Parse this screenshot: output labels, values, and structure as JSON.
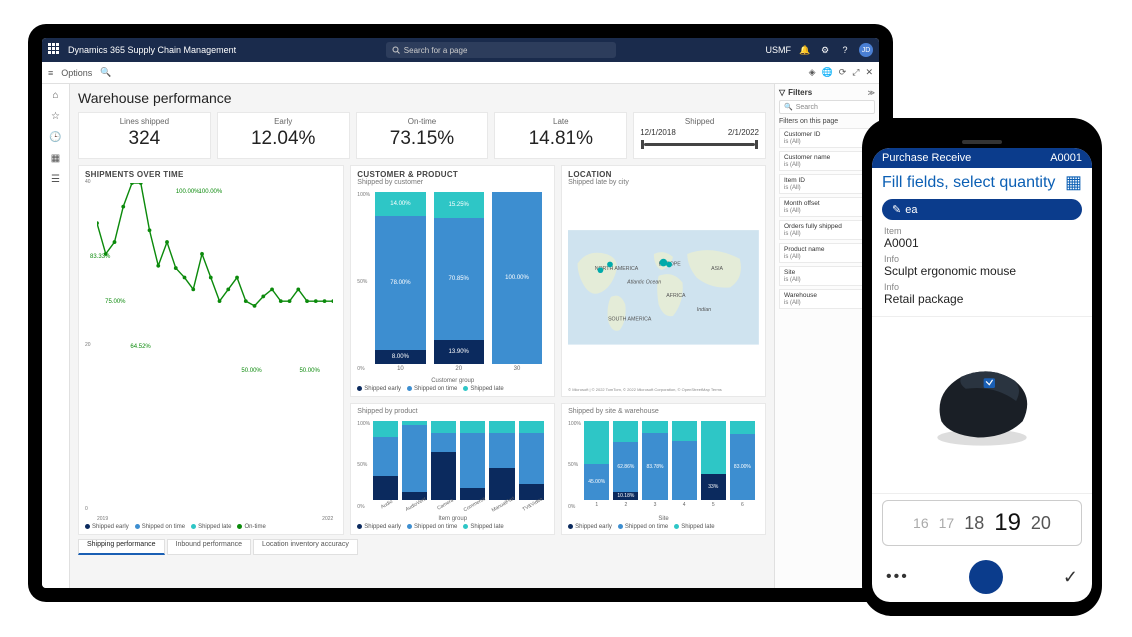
{
  "header": {
    "app_title": "Dynamics 365 Supply Chain Management",
    "search_placeholder": "Search for a page",
    "company": "USMF",
    "avatar_initials": "JD"
  },
  "subheader": {
    "options": "Options"
  },
  "page": {
    "title": "Warehouse performance"
  },
  "kpis": {
    "lines_shipped": {
      "label": "Lines shipped",
      "value": "324"
    },
    "early": {
      "label": "Early",
      "value": "12.04%"
    },
    "on_time": {
      "label": "On-time",
      "value": "73.15%"
    },
    "late": {
      "label": "Late",
      "value": "14.81%"
    },
    "shipped": {
      "label": "Shipped",
      "from": "12/1/2018",
      "to": "2/1/2022"
    }
  },
  "charts": {
    "shipments_over_time": {
      "title": "SHIPMENTS OVER TIME",
      "legend": [
        "Shipped early",
        "Shipped on time",
        "Shipped late",
        "On-time"
      ],
      "callouts": [
        "100.00%",
        "100.00%",
        "83.33%",
        "75.00%",
        "64.52%",
        "50.00%",
        "50.00%"
      ],
      "x_from": "2019",
      "x_to": "2022"
    },
    "customer_product": {
      "title": "CUSTOMER & PRODUCT"
    },
    "shipped_by_customer": {
      "subtitle": "Shipped by customer",
      "axis_label": "Customer group",
      "legend": [
        "Shipped early",
        "Shipped on time",
        "Shipped late"
      ]
    },
    "shipped_by_product": {
      "subtitle": "Shipped by product",
      "axis_label": "Item group",
      "legend": [
        "Shipped early",
        "Shipped on time",
        "Shipped late"
      ]
    },
    "location": {
      "title": "LOCATION"
    },
    "shipped_late_city": {
      "subtitle": "Shipped late by city",
      "regions": {
        "na": "NORTH AMERICA",
        "eu": "EUROPE",
        "asia": "ASIA",
        "af": "AFRICA",
        "sa": "SOUTH AMERICA",
        "ao": "Atlantic Ocean",
        "io": "Indian"
      },
      "attribution": "© Microsoft | © 2022 TomTom, © 2022 Microsoft Corporation, © OpenStreetMap Terms"
    },
    "shipped_by_site": {
      "subtitle": "Shipped by site & warehouse",
      "axis_label": "Site",
      "legend": [
        "Shipped early",
        "Shipped on time",
        "Shipped late"
      ]
    }
  },
  "chart_data": [
    {
      "type": "bar",
      "id": "shipped_by_customer",
      "categories": [
        "10",
        "20",
        "30"
      ],
      "series": [
        {
          "name": "Shipped early",
          "color": "#0b2a5e",
          "values": [
            8.0,
            13.9,
            0.0
          ]
        },
        {
          "name": "Shipped on time",
          "color": "#3d8ed0",
          "values": [
            78.0,
            70.85,
            100.0
          ]
        },
        {
          "name": "Shipped late",
          "color": "#2ec6c6",
          "values": [
            14.0,
            15.25,
            0.0
          ]
        }
      ],
      "ylabel": "%",
      "ylim": [
        0,
        100
      ],
      "xlabel": "Customer group"
    },
    {
      "type": "bar",
      "id": "shipped_by_product",
      "categories": [
        "Audio",
        "AudioVent",
        "Camera",
        "Commerce",
        "ManualPart",
        "TV&Video"
      ],
      "series": [
        {
          "name": "Shipped early",
          "color": "#0b2a5e"
        },
        {
          "name": "Shipped on time",
          "color": "#3d8ed0"
        },
        {
          "name": "Shipped late",
          "color": "#2ec6c6"
        }
      ],
      "ylabel": "%",
      "ylim": [
        0,
        100
      ],
      "xlabel": "Item group"
    },
    {
      "type": "bar",
      "id": "shipped_by_site",
      "categories": [
        "1",
        "2",
        "3",
        "4",
        "5",
        "6"
      ],
      "series": [
        {
          "name": "Shipped early",
          "color": "#0b2a5e",
          "values": [
            null,
            10.18,
            null,
            null,
            33,
            null
          ]
        },
        {
          "name": "Shipped on time",
          "color": "#3d8ed0",
          "values": [
            45.0,
            62.86,
            83.78,
            75,
            null,
            83.0
          ]
        },
        {
          "name": "Shipped late",
          "color": "#2ec6c6",
          "values": [
            55,
            27,
            16,
            25,
            67,
            17
          ]
        }
      ],
      "ylabel": "%",
      "ylim": [
        0,
        100
      ],
      "xlabel": "Site"
    },
    {
      "type": "line",
      "id": "shipments_over_time",
      "x_range": [
        "2019",
        "2022"
      ],
      "series": [
        {
          "name": "Shipped early",
          "color": "#0b2a5e",
          "type": "bar"
        },
        {
          "name": "Shipped on time",
          "color": "#3d8ed0",
          "type": "bar"
        },
        {
          "name": "Shipped late",
          "color": "#2ec6c6",
          "type": "bar"
        },
        {
          "name": "On-time %",
          "color": "#0b8a0b",
          "type": "line",
          "callouts": [
            83.33,
            75.0,
            100.0,
            100.0,
            64.52,
            50.0,
            50.0
          ]
        }
      ]
    }
  ],
  "bottom_tabs": {
    "t1": "Shipping performance",
    "t2": "Inbound performance",
    "t3": "Location inventory accuracy"
  },
  "filters": {
    "heading": "Filters",
    "search_placeholder": "Search",
    "subheading": "Filters on this page",
    "items": [
      {
        "name": "Customer ID",
        "value": "is (All)"
      },
      {
        "name": "Customer name",
        "value": "is (All)"
      },
      {
        "name": "Item ID",
        "value": "is (All)"
      },
      {
        "name": "Month offset",
        "value": "is (All)"
      },
      {
        "name": "Orders fully shipped",
        "value": "is (All)"
      },
      {
        "name": "Product name",
        "value": "is (All)"
      },
      {
        "name": "Site",
        "value": "is (All)"
      },
      {
        "name": "Warehouse",
        "value": "is (All)"
      }
    ]
  },
  "phone": {
    "header": "Purchase Receive",
    "item_code_top": "A0001",
    "subtitle": "Fill fields, select quantity",
    "chip": "ea",
    "item_label": "Item",
    "item_value": "A0001",
    "info1_label": "Info",
    "info1_value": "Sculpt ergonomic mouse",
    "info2_label": "Info",
    "info2_value": "Retail package",
    "qty_minus2": "16",
    "qty_minus1": "17",
    "qty_prev": "18",
    "qty_current": "19",
    "qty_next": "20"
  },
  "colors": {
    "early": "#0b2a5e",
    "ontime": "#3d8ed0",
    "late": "#2ec6c6",
    "line": "#0b8a0b"
  }
}
